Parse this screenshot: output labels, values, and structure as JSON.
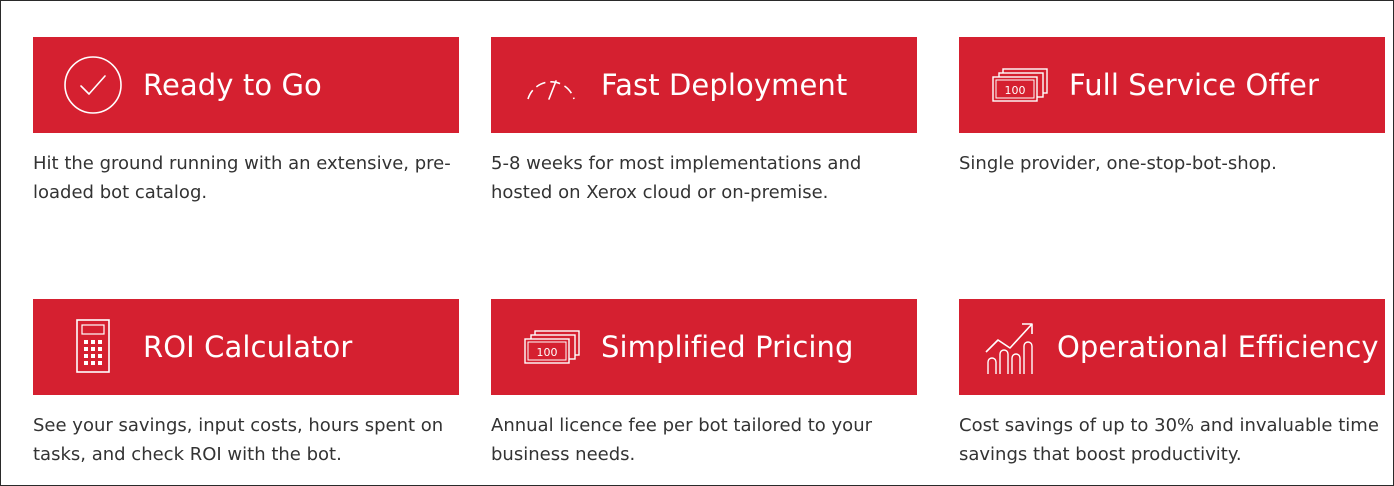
{
  "theme": {
    "accent": "#d52030",
    "text": "#333333",
    "banner_text": "#ffffff"
  },
  "features": [
    {
      "title": "Ready to Go",
      "icon": "check-circle-icon",
      "description": "Hit the ground running with an extensive, pre-loaded bot catalog."
    },
    {
      "title": "Fast Deployment",
      "icon": "speedometer-icon",
      "description": "5-8 weeks for most implementations and hosted on Xerox cloud or on-premise."
    },
    {
      "title": "Full Service Offer",
      "icon": "banknote-stack-icon",
      "icon_text": "100",
      "description": "Single provider, one-stop-bot-shop."
    },
    {
      "title": "ROI Calculator",
      "icon": "calculator-icon",
      "description": "See your savings, input costs, hours spent on tasks, and check ROI with the bot."
    },
    {
      "title": "Simplified Pricing",
      "icon": "banknote-stack-icon",
      "icon_text": "100",
      "description": "Annual licence fee per bot tailored to your business needs."
    },
    {
      "title": "Operational Efficiency",
      "icon": "growth-chart-icon",
      "description": "Cost savings of up to 30% and invaluable time savings that boost productivity."
    }
  ]
}
